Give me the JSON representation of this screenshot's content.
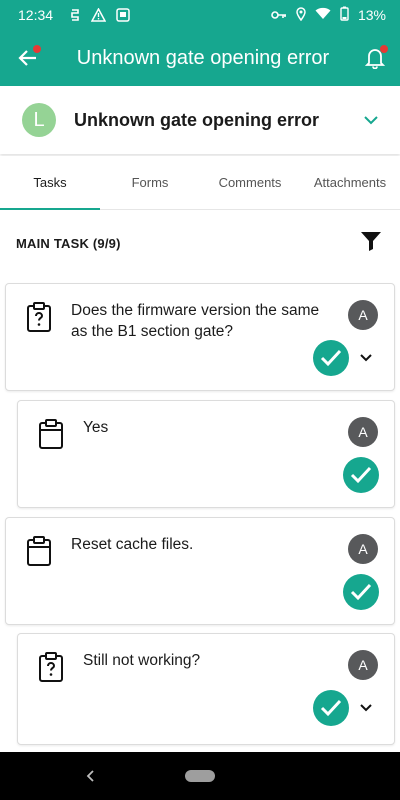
{
  "status_bar": {
    "time": "12:34",
    "battery": "13%"
  },
  "app_bar": {
    "title": "Unknown gate opening error"
  },
  "header": {
    "avatar_letter": "L",
    "title": "Unknown gate opening error"
  },
  "tabs": [
    {
      "label": "Tasks",
      "active": true
    },
    {
      "label": "Forms",
      "active": false
    },
    {
      "label": "Comments",
      "active": false
    },
    {
      "label": "Attachments",
      "active": false
    }
  ],
  "section": {
    "title": "MAIN TASK (9/9)"
  },
  "tasks": [
    {
      "text_line1": "Does the firmware version the same",
      "text_line2": "as the B1 section gate?",
      "assignee": "A",
      "icon": "clipboard-question-icon",
      "completed": true,
      "expandable": true
    },
    {
      "text_line1": "Yes",
      "assignee": "A",
      "icon": "clipboard-icon",
      "completed": true,
      "expandable": false
    },
    {
      "text_line1": "Reset cache files.",
      "assignee": "A",
      "icon": "clipboard-icon",
      "completed": true,
      "expandable": false
    },
    {
      "text_line1": "Still not working?",
      "assignee": "A",
      "icon": "clipboard-question-icon",
      "completed": true,
      "expandable": true
    }
  ],
  "colors": {
    "primary": "#16a78f",
    "badge": "#e53935",
    "avatar_header": "#95d395",
    "avatar_assignee": "#58595b"
  }
}
